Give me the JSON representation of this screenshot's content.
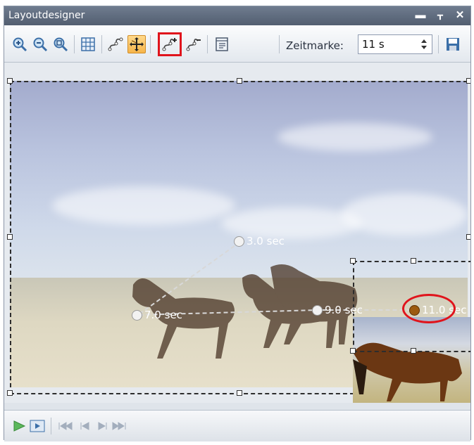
{
  "window": {
    "title": "Layoutdesigner"
  },
  "toolbar": {
    "zeitmarke_label": "Zeitmarke:",
    "zeitmarke_value": "11 s"
  },
  "keyframes": [
    {
      "label": "3.0 sec"
    },
    {
      "label": "7.0 sec"
    },
    {
      "label": "9.0 sec"
    },
    {
      "label": "11.0 sec"
    }
  ],
  "colors": {
    "highlight": "#e0141c",
    "active_tool": "#f6b54a",
    "titlebar": "#5d6a7c"
  }
}
